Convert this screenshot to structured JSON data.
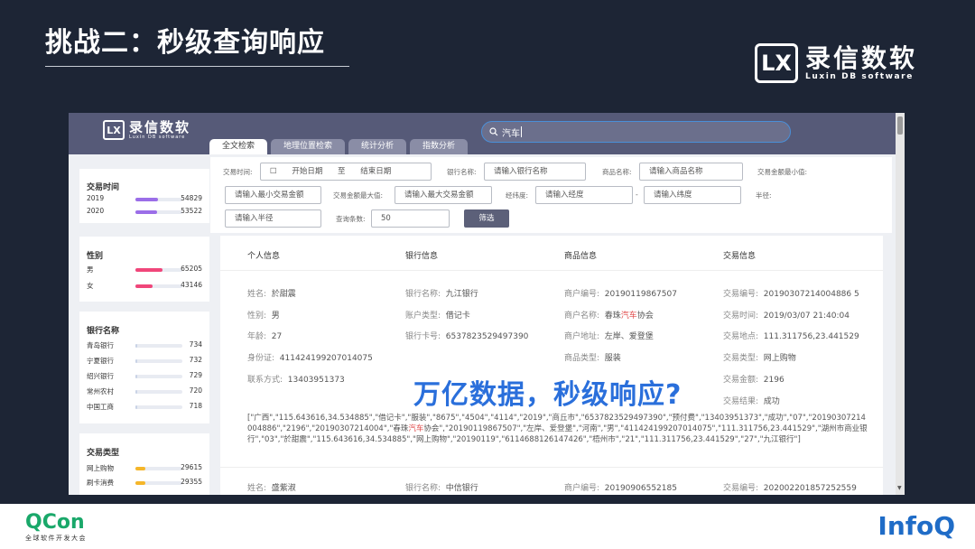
{
  "slide": {
    "title": "挑战二：秒级查询响应",
    "brand_mark": "LX",
    "brand_cn": "录信数软",
    "brand_en": "Luxin DB software",
    "overlay": "万亿数据，秒级响应?"
  },
  "app": {
    "logo_mark": "LX",
    "logo_cn": "录信数软",
    "logo_en": "Luxin DB software",
    "tabs": [
      "全文检索",
      "地理位置检索",
      "统计分析",
      "指数分析"
    ],
    "search_value": "汽车"
  },
  "filters": {
    "trade_time_label": "交易时间:",
    "start_date": "开始日期",
    "to": "至",
    "end_date": "结束日期",
    "bank_label": "银行名称:",
    "bank_placeholder": "请输入银行名称",
    "product_label": "商品名称:",
    "product_placeholder": "请输入商品名称",
    "min_amount_label": "交易金额最小值:",
    "min_amount_placeholder": "请输入最小交易金额",
    "max_amount_label": "交易金额最大值:",
    "max_amount_placeholder": "请输入最大交易金额",
    "latlng_label": "经纬度:",
    "lng_placeholder": "请输入经度",
    "dash": "-",
    "lat_placeholder": "请输入纬度",
    "radius_label": "半径:",
    "radius_placeholder": "请输入半径",
    "count_label": "查询条数:",
    "count_value": "50",
    "filter_button": "筛选"
  },
  "facets": {
    "time": {
      "title": "交易时间",
      "items": [
        {
          "label": "2019",
          "count": "54829",
          "fraction": 0.48
        },
        {
          "label": "2020",
          "count": "53522",
          "fraction": 0.46
        }
      ]
    },
    "gender": {
      "title": "性别",
      "items": [
        {
          "label": "男",
          "count": "65205",
          "fraction": 0.58
        },
        {
          "label": "女",
          "count": "43146",
          "fraction": 0.36
        }
      ]
    },
    "bank": {
      "title": "银行名称",
      "items": [
        {
          "label": "青岛银行",
          "count": "734",
          "fraction": 0.03
        },
        {
          "label": "宁夏银行",
          "count": "732",
          "fraction": 0.03
        },
        {
          "label": "绍兴银行",
          "count": "729",
          "fraction": 0.03
        },
        {
          "label": "常州农村",
          "count": "720",
          "fraction": 0.03
        },
        {
          "label": "中国工商",
          "count": "718",
          "fraction": 0.03
        }
      ]
    },
    "type": {
      "title": "交易类型",
      "items": [
        {
          "label": "网上购物",
          "count": "29615",
          "fraction": 0.22
        },
        {
          "label": "刷卡消费",
          "count": "29355",
          "fraction": 0.22
        }
      ]
    }
  },
  "result": {
    "headers": [
      "个人信息",
      "银行信息",
      "商品信息",
      "交易信息"
    ],
    "personal": {
      "name_k": "姓名:",
      "name_v": "於甜震",
      "gender_k": "性别:",
      "gender_v": "男",
      "age_k": "年龄:",
      "age_v": "27",
      "id_k": "身份证:",
      "id_v": "411424199207014075",
      "phone_k": "联系方式:",
      "phone_v": "13403951373"
    },
    "bank": {
      "name_k": "银行名称:",
      "name_v": "九江银行",
      "acct_k": "账户类型:",
      "acct_v": "借记卡",
      "card_k": "银行卡号:",
      "card_v": "6537823529497390"
    },
    "product": {
      "code_k": "商户编号:",
      "code_v": "20190119867507",
      "name_k": "商户名称:",
      "name_pre": "春珠",
      "name_hl": "汽车",
      "name_post": "协会",
      "addr_k": "商户地址:",
      "addr_v": "左岸、爱登堡",
      "type_k": "商品类型:",
      "type_v": "服装"
    },
    "trade": {
      "no_k": "交易编号:",
      "no_v": "20190307214004886 5",
      "time_k": "交易时间:",
      "time_v": "2019/03/07 21:40:04",
      "loc_k": "交易地点:",
      "loc_v": "111.311756,23.441529",
      "kind_k": "交易类型:",
      "kind_v": "网上购物",
      "amt_k": "交易金额:",
      "amt_v": "2196",
      "res_k": "交易结果:",
      "res_v": "成功"
    },
    "raw_pre": "[\"广西\",\"115.643616,34.534885\",\"借记卡\",\"服装\",\"8675\",\"4504\",\"4114\",\"2019\",\"商丘市\",\"6537823529497390\",\"预付费\",\"13403951373\",\"成功\",\"07\",\"20190307214004886\",\"2196\",\"20190307214004\",\"春珠",
    "raw_hl": "汽车",
    "raw_post": "协会\",\"20190119867507\",\"左岸、爱登堡\",\"河南\",\"男\",\"411424199207014075\",\"111.311756,23.441529\",\"湖州市商业银行\",\"03\",\"於甜震\",\"115.643616,34.534885\",\"网上购物\",\"20190119\",\"6114688126147426\",\"梧州市\",\"21\",\"111.311756,23.441529\",\"27\",\"九江银行\"]",
    "next": {
      "name_k": "姓名:",
      "name_v": "盛紫淑",
      "bank_k": "银行名称:",
      "bank_v": "中信银行",
      "code_k": "商户编号:",
      "code_v": "20190906552185",
      "no_k": "交易编号:",
      "no_v": "202002201857252559"
    }
  },
  "footer": {
    "qcon": "QCon",
    "qcon_sub": "全球软件开发大会",
    "infoq": "InfoQ"
  },
  "colors": {
    "time_bar": "#9b6ee8",
    "gender_bar": "#f0467a",
    "bank_bar": "#c9d3e6",
    "type_bar": "#f5b62a",
    "highlight": "#e04b4b",
    "overlay": "#2a6fdb"
  }
}
